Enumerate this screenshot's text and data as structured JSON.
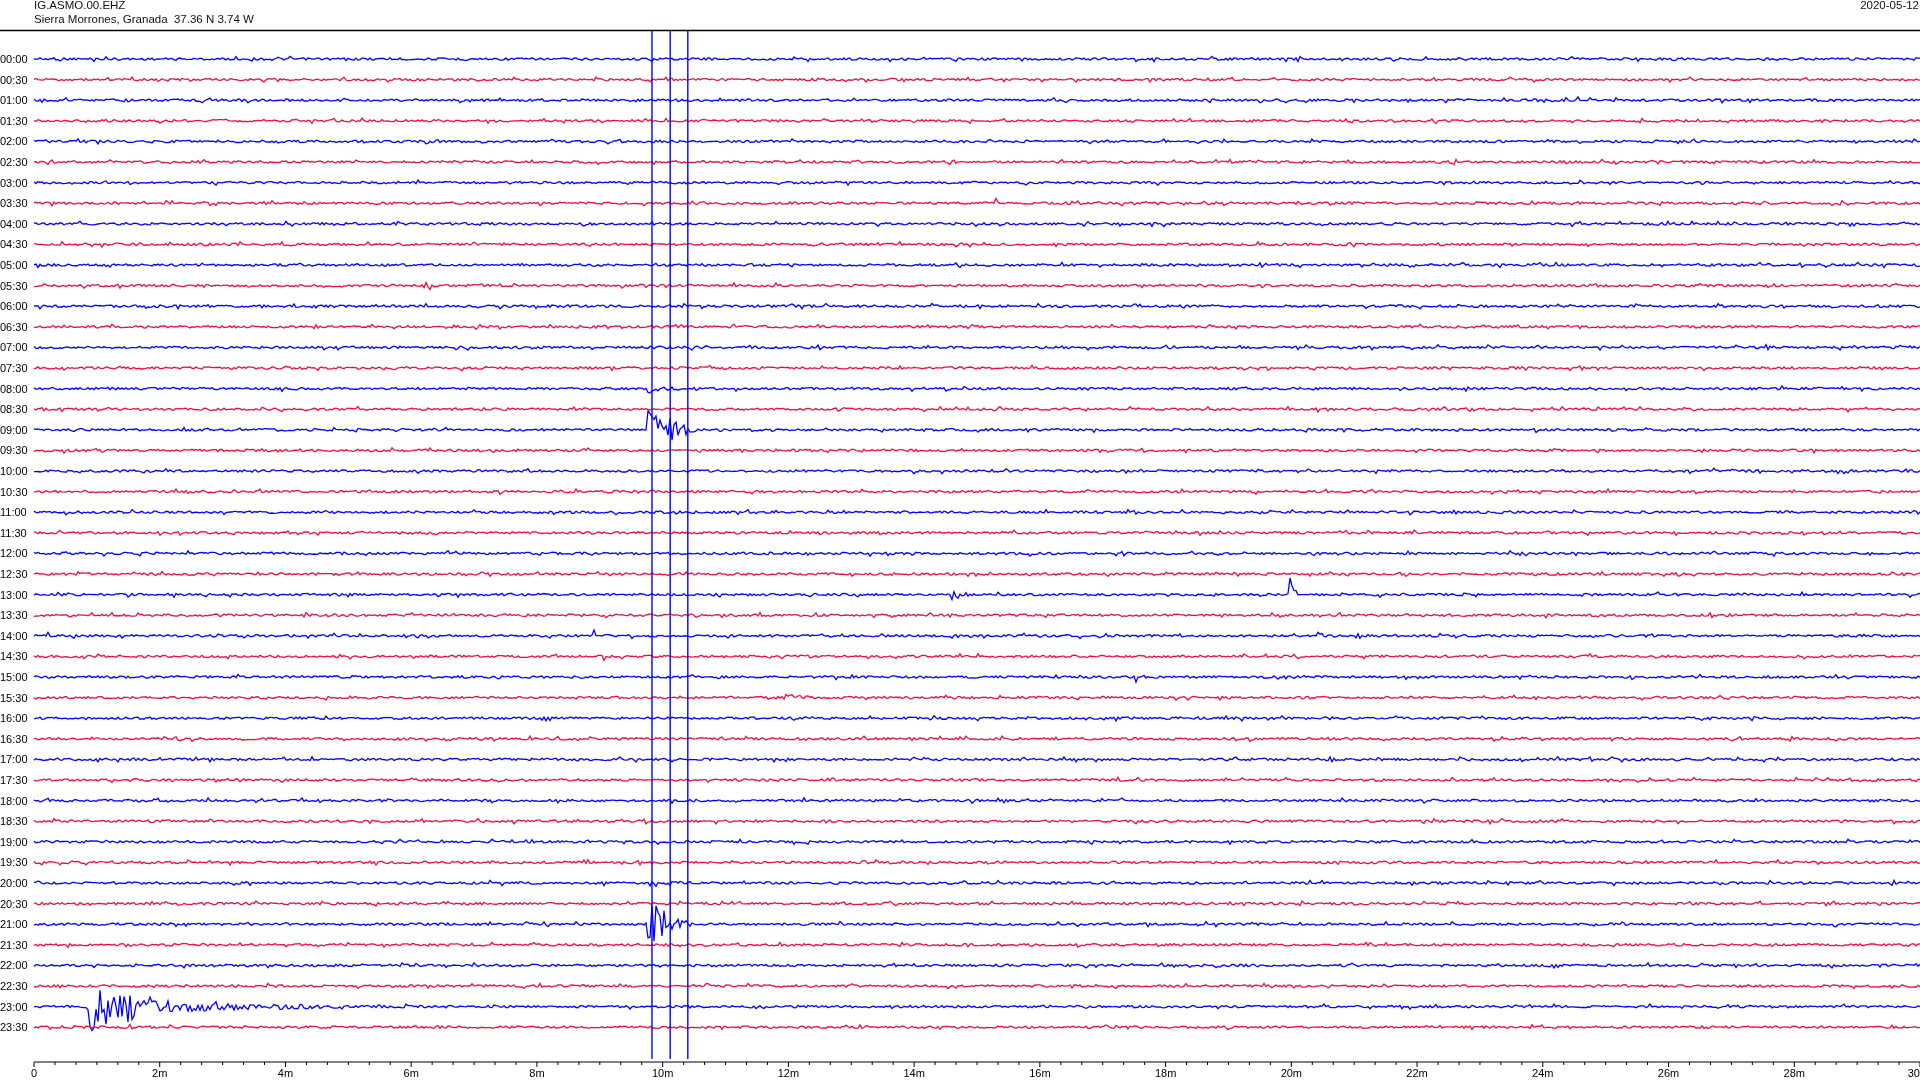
{
  "header": {
    "station": "IG.ASMO.00.EHZ",
    "location": "Sierra Morrones, Granada  37.36 N 3.74 W",
    "date": "2020-05-12"
  },
  "trace_rows": [
    {
      "label": "00:00",
      "color": "#0000ff"
    },
    {
      "label": "00:30",
      "color": "#e8103c"
    },
    {
      "label": "01:00",
      "color": "#0000ff"
    },
    {
      "label": "01:30",
      "color": "#e8103c"
    },
    {
      "label": "02:00",
      "color": "#0000ff"
    },
    {
      "label": "02:30",
      "color": "#e8103c"
    },
    {
      "label": "03:00",
      "color": "#0000ff"
    },
    {
      "label": "03:30",
      "color": "#e8103c"
    },
    {
      "label": "04:00",
      "color": "#0000ff"
    },
    {
      "label": "04:30",
      "color": "#e8103c"
    },
    {
      "label": "05:00",
      "color": "#0000ff"
    },
    {
      "label": "05:30",
      "color": "#e8103c"
    },
    {
      "label": "06:00",
      "color": "#0000ff"
    },
    {
      "label": "06:30",
      "color": "#e8103c"
    },
    {
      "label": "07:00",
      "color": "#0000ff"
    },
    {
      "label": "07:30",
      "color": "#e8103c"
    },
    {
      "label": "08:00",
      "color": "#0000ff"
    },
    {
      "label": "08:30",
      "color": "#e8103c"
    },
    {
      "label": "09:00",
      "color": "#0000ff"
    },
    {
      "label": "09:30",
      "color": "#e8103c"
    },
    {
      "label": "10:00",
      "color": "#0000ff"
    },
    {
      "label": "10:30",
      "color": "#e8103c"
    },
    {
      "label": "11:00",
      "color": "#0000ff"
    },
    {
      "label": "11:30",
      "color": "#e8103c"
    },
    {
      "label": "12:00",
      "color": "#0000ff"
    },
    {
      "label": "12:30",
      "color": "#e8103c"
    },
    {
      "label": "13:00",
      "color": "#0000ff"
    },
    {
      "label": "13:30",
      "color": "#e8103c"
    },
    {
      "label": "14:00",
      "color": "#0000ff"
    },
    {
      "label": "14:30",
      "color": "#e8103c"
    },
    {
      "label": "15:00",
      "color": "#0000ff"
    },
    {
      "label": "15:30",
      "color": "#e8103c"
    },
    {
      "label": "16:00",
      "color": "#0000ff"
    },
    {
      "label": "16:30",
      "color": "#e8103c"
    },
    {
      "label": "17:00",
      "color": "#0000ff"
    },
    {
      "label": "17:30",
      "color": "#e8103c"
    },
    {
      "label": "18:00",
      "color": "#0000ff"
    },
    {
      "label": "18:30",
      "color": "#e8103c"
    },
    {
      "label": "19:00",
      "color": "#0000ff"
    },
    {
      "label": "19:30",
      "color": "#e8103c"
    },
    {
      "label": "20:00",
      "color": "#0000ff"
    },
    {
      "label": "20:30",
      "color": "#e8103c"
    },
    {
      "label": "21:00",
      "color": "#0000ff"
    },
    {
      "label": "21:30",
      "color": "#e8103c"
    },
    {
      "label": "22:00",
      "color": "#0000ff"
    },
    {
      "label": "22:30",
      "color": "#e8103c"
    },
    {
      "label": "23:00",
      "color": "#0000ff"
    },
    {
      "label": "23:30",
      "color": "#e8103c"
    }
  ],
  "time_axis": {
    "tick_labels": [
      "0",
      "2m",
      "4m",
      "6m",
      "8m",
      "10m",
      "12m",
      "14m",
      "16m",
      "18m",
      "20m",
      "22m",
      "24m",
      "26m",
      "28m",
      "30"
    ]
  }
}
